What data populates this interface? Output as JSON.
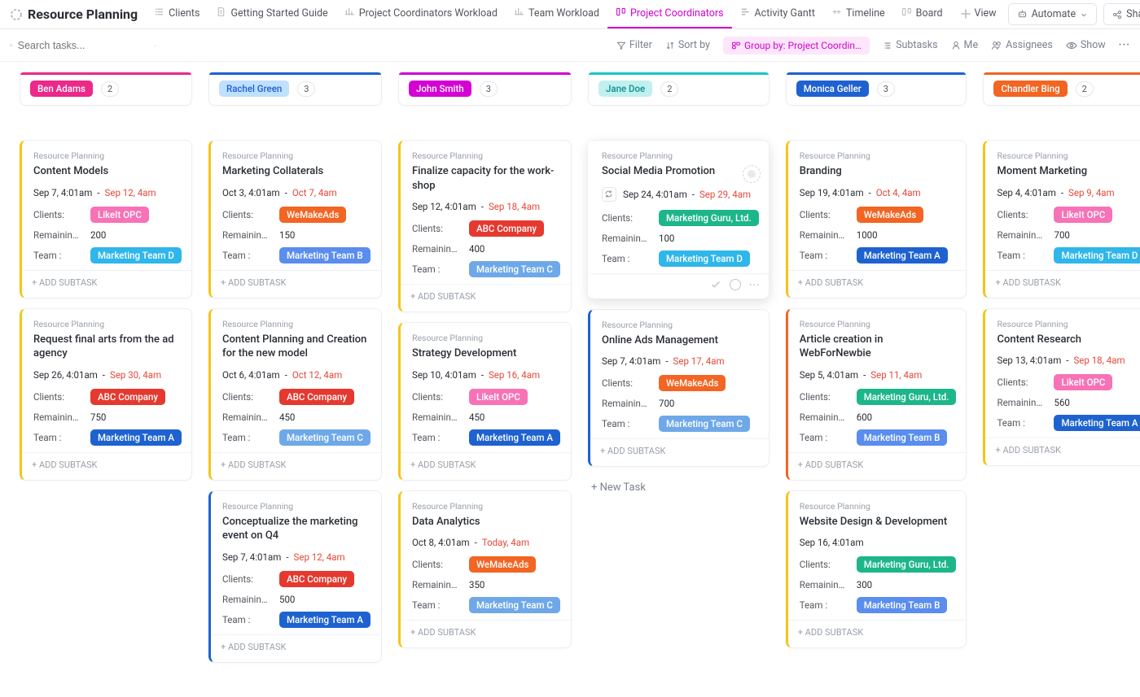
{
  "header": {
    "app_title": "Resource Planning",
    "tabs": [
      {
        "label": "Clients"
      },
      {
        "label": "Getting Started Guide"
      },
      {
        "label": "Project Coordinators Workload"
      },
      {
        "label": "Team Workload"
      },
      {
        "label": "Project Coordinators",
        "active": true
      },
      {
        "label": "Activity Gantt"
      },
      {
        "label": "Timeline"
      },
      {
        "label": "Board"
      }
    ],
    "add_view": "View",
    "automate": "Automate",
    "share": "Share"
  },
  "toolbar": {
    "search_placeholder": "Search tasks...",
    "filter": "Filter",
    "sort": "Sort by",
    "group": "Group by: Project Coordin…",
    "subtasks": "Subtasks",
    "me": "Me",
    "assignees": "Assignees",
    "show": "Show"
  },
  "labels": {
    "clients": "Clients:",
    "remaining": "Remaining …",
    "team": "Team :",
    "add_subtask": "+ ADD SUBTASK",
    "new_task": "+ New Task",
    "crumb": "Resource Planning"
  },
  "colors": {
    "tag": {
      "LikeIt OPC": "#f772b6",
      "WeMakeAds": "#f26522",
      "ABC Company": "#e5392f",
      "Marketing Guru, Ltd.": "#1db68a",
      "Marketing Team A": "#1e62d0",
      "Marketing Team B": "#5a8dee",
      "Marketing Team C": "#6ea8e8",
      "Marketing Team D": "#2fb6ea"
    }
  },
  "columns": [
    {
      "name": "Ben Adams",
      "count": "2",
      "accent": "#ec2889",
      "chip_bg": "#ec2889",
      "chip_fg": "#ffffff",
      "cards": [
        {
          "stripe": "#f5c518",
          "title": "Content Models",
          "start": "Sep 7, 4:01am",
          "due": "Sep 12, 4am",
          "client": "LikeIt OPC",
          "remaining": "200",
          "team": "Marketing Team D"
        },
        {
          "stripe": "#f5c518",
          "title": "Request final arts from the ad agency",
          "start": "Sep 26, 4:01am",
          "due": "Sep 30, 4am",
          "client": "ABC Company",
          "remaining": "750",
          "team": "Marketing Team A"
        }
      ]
    },
    {
      "name": "Rachel Green",
      "count": "3",
      "accent": "#1e62d0",
      "chip_bg": "#bfe0ff",
      "chip_fg": "#1e62d0",
      "cards": [
        {
          "stripe": "#f5c518",
          "title": "Marketing Collaterals",
          "start": "Oct 3, 4:01am",
          "due": "Oct 7, 4am",
          "client": "WeMakeAds",
          "remaining": "150",
          "team": "Marketing Team B"
        },
        {
          "stripe": "#f5c518",
          "title": "Content Planning and Creation for the new model",
          "start": "Oct 6, 4:01am",
          "due": "Oct 12, 4am",
          "client": "ABC Company",
          "remaining": "450",
          "team": "Marketing Team C"
        },
        {
          "stripe": "#1e62d0",
          "title": "Conceptualize the marketing event on Q4",
          "start": "Sep 7, 4:01am",
          "due": "Sep 12, 4am",
          "client": "ABC Company",
          "remaining": "500",
          "team": "Marketing Team A"
        }
      ]
    },
    {
      "name": "John Smith",
      "count": "3",
      "accent": "#d400d4",
      "chip_bg": "#d400d4",
      "chip_fg": "#ffffff",
      "cards": [
        {
          "stripe": "#f5c518",
          "title": "Finalize capacity for the work-shop",
          "start": "Sep 12, 4:01am",
          "due": "Sep 18, 4am",
          "client": "ABC Company",
          "remaining": "400",
          "team": "Marketing Team C"
        },
        {
          "stripe": "#f5c518",
          "title": "Strategy Development",
          "start": "Sep 10, 4:01am",
          "due": "Sep 16, 4am",
          "client": "LikeIt OPC",
          "remaining": "450",
          "team": "Marketing Team A"
        },
        {
          "stripe": "#f5c518",
          "title": "Data Analytics",
          "start": "Oct 8, 4:01am",
          "due": "Today, 4am",
          "client": "WeMakeAds",
          "remaining": "350",
          "team": "Marketing Team C"
        }
      ]
    },
    {
      "name": "Jane Doe",
      "count": "2",
      "accent": "#17c7c7",
      "chip_bg": "#c1f0ef",
      "chip_fg": "#0e8f8f",
      "cards": [
        {
          "stripe": "#ffffff",
          "hover": true,
          "recur": true,
          "title": "Social Media Promotion",
          "start": "Sep 24, 4:01am",
          "due": "Sep 29, 4am",
          "client": "Marketing Guru, Ltd.",
          "remaining": "100",
          "team": "Marketing Team D"
        },
        {
          "stripe": "#1e62d0",
          "title": "Online Ads Management",
          "start": "Sep 7, 4:01am",
          "due": "Sep 17, 4am",
          "client": "WeMakeAds",
          "remaining": "700",
          "team": "Marketing Team C"
        }
      ],
      "show_new_task": true
    },
    {
      "name": "Monica Geller",
      "count": "3",
      "accent": "#1e62d0",
      "chip_bg": "#1e62d0",
      "chip_fg": "#ffffff",
      "cards": [
        {
          "stripe": "#f5c518",
          "title": "Branding",
          "start": "Sep 19, 4:01am",
          "due": "Oct 4, 4am",
          "client": "WeMakeAds",
          "remaining": "1000",
          "team": "Marketing Team A"
        },
        {
          "stripe": "#f26522",
          "title": "Article creation in WebForNewbie",
          "start": "Sep 5, 4:01am",
          "due": "Sep 11, 4am",
          "client": "Marketing Guru, Ltd.",
          "remaining": "600",
          "team": "Marketing Team B"
        },
        {
          "stripe": "#f5c518",
          "title": "Website Design & Development",
          "start": "Sep 16, 4:01am",
          "due": "",
          "client": "Marketing Guru, Ltd.",
          "remaining": "300",
          "team": "Marketing Team B"
        }
      ]
    },
    {
      "name": "Chandler Bing",
      "count": "2",
      "accent": "#f26522",
      "chip_bg": "#f26522",
      "chip_fg": "#ffffff",
      "cards": [
        {
          "stripe": "#f5c518",
          "title": "Moment Marketing",
          "start": "Sep 4, 4:01am",
          "due": "Sep 9, 4am",
          "client": "LikeIt OPC",
          "remaining": "700",
          "team": "Marketing Team D"
        },
        {
          "stripe": "#f5c518",
          "title": "Content Research",
          "start": "Sep 13, 4:01am",
          "due": "Sep 18, 4am",
          "client": "LikeIt OPC",
          "remaining": "560",
          "team": "Marketing Team A"
        }
      ]
    }
  ]
}
